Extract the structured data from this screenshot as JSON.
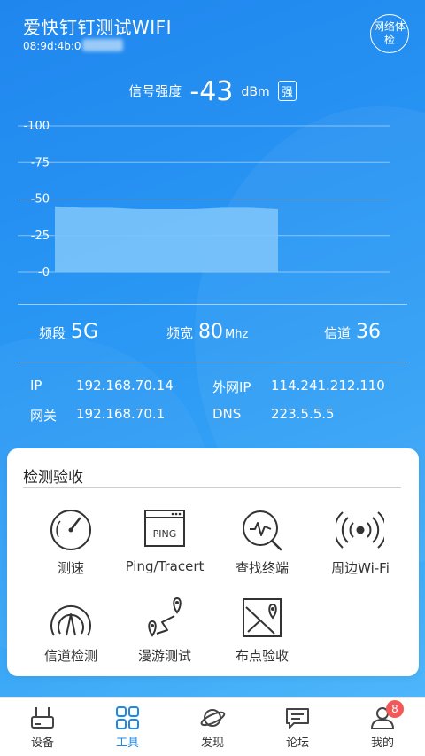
{
  "header": {
    "title": "爱快钉钉测试WIFI",
    "mac_prefix": "08:9d:4b:0",
    "check_button": "网络体检"
  },
  "signal": {
    "label": "信号强度",
    "value": "-43",
    "unit": "dBm",
    "quality": "强"
  },
  "chart_data": {
    "type": "area",
    "y_ticks": [
      "-100",
      "-75",
      "-50",
      "-25",
      "-0"
    ],
    "ylim": [
      0,
      -100
    ],
    "values": [
      -45,
      -44,
      -44,
      -43,
      -43,
      -43,
      -44,
      -44,
      -43
    ],
    "fill_color": "#7cc4fb",
    "grid": true
  },
  "band": {
    "band_label": "频段",
    "band_value": "5G",
    "width_label": "频宽",
    "width_value": "80",
    "width_unit": "Mhz",
    "channel_label": "信道",
    "channel_value": "36"
  },
  "net": {
    "ip_label": "IP",
    "ip_value": "192.168.70.14",
    "wan_label": "外网IP",
    "wan_value": "114.241.212.110",
    "gw_label": "网关",
    "gw_value": "192.168.70.1",
    "dns_label": "DNS",
    "dns_value": "223.5.5.5"
  },
  "tools": {
    "title": "检测验收",
    "items": [
      {
        "label": "测速",
        "icon": "speedometer-icon"
      },
      {
        "label": "Ping/Tracert",
        "icon": "ping-window-icon",
        "icon_text": "PING"
      },
      {
        "label": "查找终端",
        "icon": "search-terminal-icon"
      },
      {
        "label": "周边Wi-Fi",
        "icon": "broadcast-icon"
      },
      {
        "label": "信道检测",
        "icon": "channel-antenna-icon"
      },
      {
        "label": "漫游测试",
        "icon": "roaming-route-icon"
      },
      {
        "label": "布点验收",
        "icon": "map-placement-icon"
      }
    ]
  },
  "tabbar": {
    "items": [
      {
        "label": "设备",
        "icon": "router-icon"
      },
      {
        "label": "工具",
        "icon": "grid-tools-icon",
        "active": true
      },
      {
        "label": "发现",
        "icon": "planet-icon"
      },
      {
        "label": "论坛",
        "icon": "chat-icon"
      },
      {
        "label": "我的",
        "icon": "user-icon"
      }
    ],
    "badge_count": "8"
  },
  "colors": {
    "primary": "#1e88e5",
    "badge": "#f25858"
  }
}
